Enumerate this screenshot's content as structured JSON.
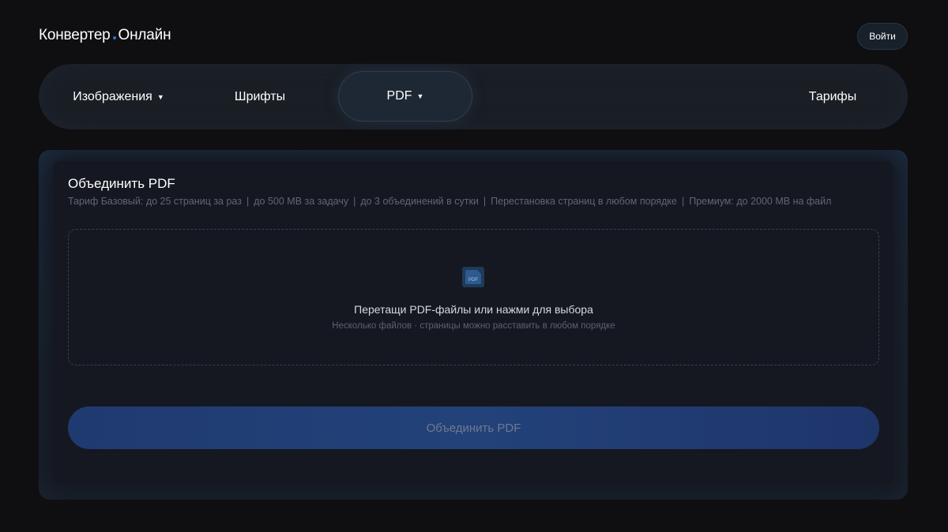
{
  "header": {
    "logo_left": "Конвертер",
    "logo_right": "Онлайн",
    "login_label": "Войти"
  },
  "nav": {
    "items": [
      {
        "label": "Изображения",
        "caret": "▼"
      },
      {
        "label": "Шрифты"
      },
      {
        "label": "PDF",
        "caret": "▼",
        "active": true
      },
      {
        "label": "Тарифы"
      }
    ]
  },
  "card": {
    "title": "Объединить PDF",
    "limits": [
      "Тариф Базовый: до 25 страниц за раз",
      "до 500 МВ за задачу",
      "до 3 объединений в сутки",
      "Перестановка страниц в любом порядке",
      "Премиум: до 2000 МВ на файл"
    ],
    "separator": "|",
    "dropzone": {
      "icon": "pdf-file-icon",
      "icon_text": "PDF",
      "main_text": "Перетащи PDF-файлы или нажми для выбора",
      "hint_text": "Несколько файлов · страницы можно расставить в любом порядке"
    },
    "merge_button_label": "Объединить PDF"
  },
  "colors": {
    "background": "#0f0f11",
    "accent": "#23427a",
    "logo_dot": "#3b6fb8"
  }
}
